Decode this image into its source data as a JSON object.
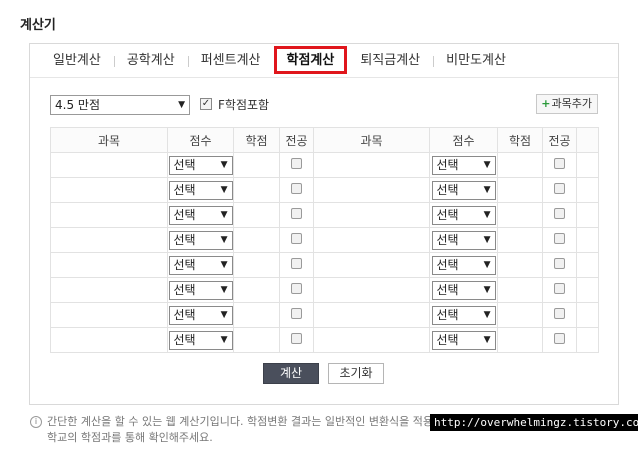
{
  "page_title": "계산기",
  "tabs": [
    "일반계산",
    "공학계산",
    "퍼센트계산",
    "학점계산",
    "퇴직금계산",
    "비만도계산"
  ],
  "active_tab": "학점계산",
  "controls": {
    "scale_select": "4.5 만점",
    "f_include_label": "F학점포함",
    "f_include_checked": true,
    "add_course_label": "과목추가"
  },
  "table": {
    "headers": [
      "과목",
      "점수",
      "학점",
      "전공",
      "과목",
      "점수",
      "학점",
      "전공"
    ],
    "select_placeholder": "선택",
    "row_count": 8
  },
  "buttons": {
    "calculate": "계산",
    "reset": "초기화"
  },
  "notice": {
    "line1": "간단한 계산을 할 수 있는 웹 계산기입니다. 학점변환 결과는 일반적인 변환식을 적용한",
    "line2": "학교의 학점과를 통해 확인해주세요."
  },
  "watermark": "http://overwhelmingz.tistory.com",
  "colors": {
    "active_highlight": "#e0161c",
    "calc_button": "#4a4f5c",
    "plus_icon": "#2a9a3a"
  }
}
